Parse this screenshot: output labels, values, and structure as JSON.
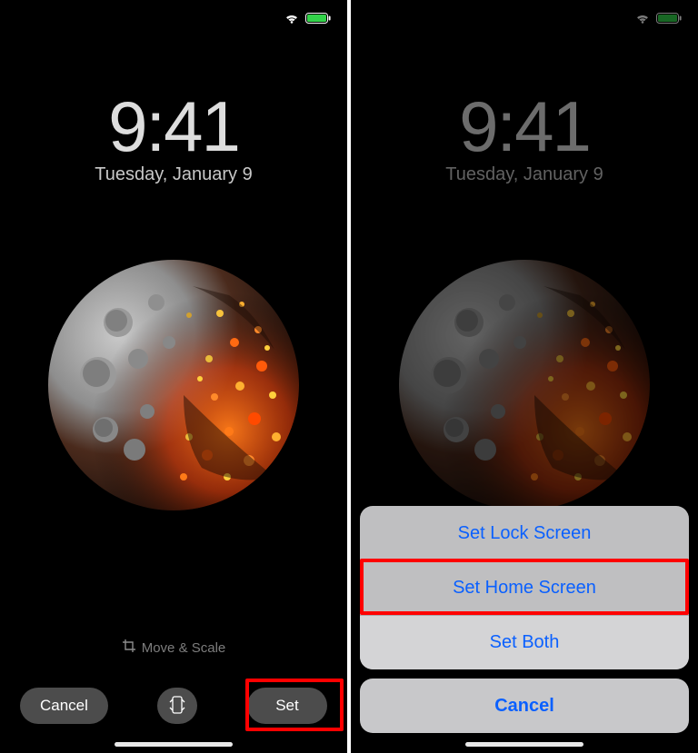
{
  "status": {
    "battery_color": "#33d34a"
  },
  "lock": {
    "time": "9:41",
    "date": "Tuesday, January 9"
  },
  "hint": {
    "move_scale": "Move & Scale"
  },
  "buttons": {
    "cancel": "Cancel",
    "set": "Set"
  },
  "sheet": {
    "lock": "Set Lock Screen",
    "home": "Set Home Screen",
    "both": "Set Both",
    "cancel": "Cancel"
  }
}
